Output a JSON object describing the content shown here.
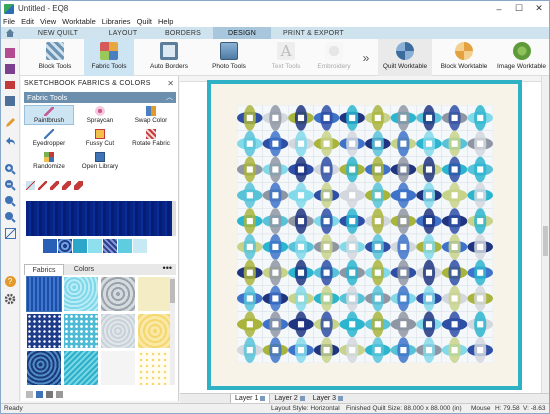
{
  "window": {
    "title": "Untitled - EQ8",
    "minimize": "–",
    "maximize": "☐",
    "close": "✕"
  },
  "menu": [
    "File",
    "Edit",
    "View",
    "Worktable",
    "Libraries",
    "Quilt",
    "Help"
  ],
  "tabs": [
    "NEW QUILT",
    "LAYOUT",
    "BORDERS",
    "DESIGN",
    "PRINT & EXPORT"
  ],
  "active_tab": "DESIGN",
  "ribbon": {
    "tools": [
      {
        "label": "Block Tools",
        "icon": "block-tools-icon"
      },
      {
        "label": "Fabric Tools",
        "icon": "fabric-tools-icon"
      },
      {
        "label": "Auto Borders",
        "icon": "auto-borders-icon"
      },
      {
        "label": "Photo Tools",
        "icon": "photo-tools-icon"
      },
      {
        "label": "Text Tools",
        "icon": "text-tools-icon"
      },
      {
        "label": "Embroidery",
        "icon": "embroidery-icon"
      }
    ],
    "more": "»",
    "worktables": [
      {
        "label": "Quilt Worktable",
        "icon": "quilt-worktable-icon"
      },
      {
        "label": "Block Worktable",
        "icon": "block-worktable-icon"
      },
      {
        "label": "Image Worktable",
        "icon": "image-worktable-icon"
      }
    ]
  },
  "panel": {
    "title": "SKETCHBOOK FABRICS & COLORS",
    "close": "✕",
    "section": "Fabric Tools",
    "collapse": "︿",
    "tools": [
      {
        "label": "Paintbrush",
        "icon": "paintbrush-icon"
      },
      {
        "label": "Spraycan",
        "icon": "spraycan-icon"
      },
      {
        "label": "Swap Color",
        "icon": "swap-color-icon"
      },
      {
        "label": "Eyedropper",
        "icon": "eyedropper-icon"
      },
      {
        "label": "Fussy Cut",
        "icon": "fussy-cut-icon"
      },
      {
        "label": "Rotate Fabric",
        "icon": "rotate-fabric-icon"
      },
      {
        "label": "Randomize",
        "icon": "randomize-icon"
      },
      {
        "label": "Open Library",
        "icon": "open-library-icon"
      }
    ],
    "fabric_tab": "Fabrics",
    "color_tab": "Colors",
    "more": "•••"
  },
  "layers": [
    "Layer 1",
    "Layer 2",
    "Layer 3"
  ],
  "status": {
    "ready": "Ready",
    "layout_style": "Layout Style: Horizontal",
    "finished_size": "Finished Quilt Size: 88.000 x 88.000 (in)",
    "mouse": "Mouse",
    "h": "H: 79.58",
    "v": "V: -8.63"
  },
  "colors": {
    "accent": "#6c8fae",
    "tab_bar": "#cfe3ee",
    "quilt_border": "#2eb1c5",
    "quilt_inner": "#f7f3e8"
  }
}
